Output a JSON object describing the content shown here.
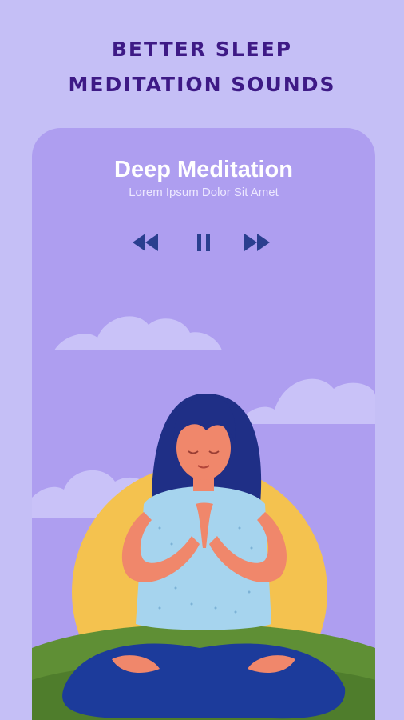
{
  "headline": {
    "line1": "BETTER SLEEP",
    "line2": "MEDITATION SOUNDS"
  },
  "player": {
    "title": "Deep Meditation",
    "subtitle": "Lorem Ipsum Dolor Sit Amet",
    "controls": {
      "rewind_icon": "rewind-icon",
      "pause_icon": "pause-icon",
      "forward_icon": "fast-forward-icon"
    }
  },
  "colors": {
    "background": "#c5bff6",
    "card": "#ae9ef0",
    "headline": "#3e1a86",
    "controls": "#2a3f8f",
    "sun": "#f4c24f",
    "grass": "#5f8f35"
  }
}
